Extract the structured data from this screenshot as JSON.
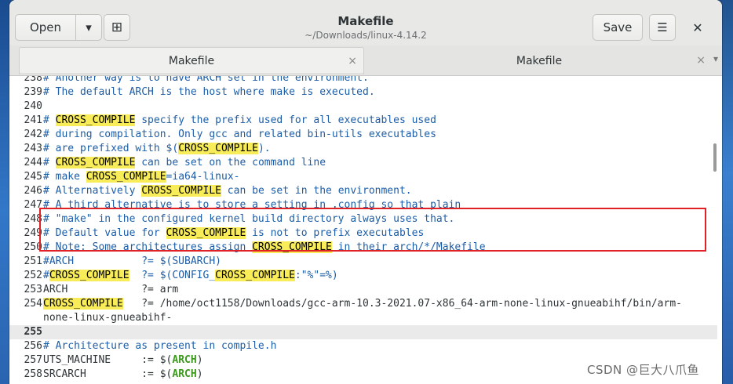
{
  "window": {
    "title": "Makefile",
    "subtitle": "~/Downloads/linux-4.14.2",
    "open_label": "Open",
    "open_menu_icon": "▾",
    "new_tab_icon": "⊞",
    "save_label": "Save",
    "menu_icon": "☰",
    "close_icon": "✕"
  },
  "tabs": [
    {
      "label": "Makefile",
      "close": "×"
    },
    {
      "label": "Makefile",
      "close": "×"
    }
  ],
  "tab_overflow_icon": "▾",
  "colors": {
    "highlight": "#f8ec58",
    "comment": "#1c5da7",
    "variable": "#3b9a1c",
    "annotation_box": "#e02226"
  },
  "lines": [
    {
      "num": "238",
      "segments": [
        {
          "t": "# Another way is to have ARCH set in the environment.",
          "s": "c"
        }
      ]
    },
    {
      "num": "239",
      "segments": [
        {
          "t": "# The default ARCH is the host where make is executed.",
          "s": "c"
        }
      ]
    },
    {
      "num": "240",
      "segments": []
    },
    {
      "num": "241",
      "segments": [
        {
          "t": "# ",
          "s": "c"
        },
        {
          "t": "CROSS_COMPILE",
          "s": "hl"
        },
        {
          "t": " specify the prefix used for all executables used",
          "s": "c"
        }
      ]
    },
    {
      "num": "242",
      "segments": [
        {
          "t": "# during compilation. Only gcc and related bin-utils executables",
          "s": "c"
        }
      ]
    },
    {
      "num": "243",
      "segments": [
        {
          "t": "# are prefixed with $(",
          "s": "c"
        },
        {
          "t": "CROSS_COMPILE",
          "s": "hl"
        },
        {
          "t": ").",
          "s": "c"
        }
      ]
    },
    {
      "num": "244",
      "segments": [
        {
          "t": "# ",
          "s": "c"
        },
        {
          "t": "CROSS_COMPILE",
          "s": "hl"
        },
        {
          "t": " can be set on the command line",
          "s": "c"
        }
      ]
    },
    {
      "num": "245",
      "segments": [
        {
          "t": "# make ",
          "s": "c"
        },
        {
          "t": "CROSS_COMPILE",
          "s": "hl"
        },
        {
          "t": "=ia64-linux-",
          "s": "c"
        }
      ]
    },
    {
      "num": "246",
      "segments": [
        {
          "t": "# Alternatively ",
          "s": "c"
        },
        {
          "t": "CROSS_COMPILE",
          "s": "hl"
        },
        {
          "t": " can be set in the environment.",
          "s": "c"
        }
      ]
    },
    {
      "num": "247",
      "segments": [
        {
          "t": "# A third alternative is to store a setting in .config so that plain",
          "s": "c"
        }
      ]
    },
    {
      "num": "248",
      "segments": [
        {
          "t": "# \"make\" in the configured kernel build directory always uses that.",
          "s": "c"
        }
      ]
    },
    {
      "num": "249",
      "segments": [
        {
          "t": "# Default value for ",
          "s": "c"
        },
        {
          "t": "CROSS_COMPILE",
          "s": "hl"
        },
        {
          "t": " is not to prefix executables",
          "s": "c"
        }
      ]
    },
    {
      "num": "250",
      "segments": [
        {
          "t": "# Note: Some architectures assign ",
          "s": "c"
        },
        {
          "t": "CROSS_COMPILE",
          "s": "hl"
        },
        {
          "t": " in their arch/*/Makefile",
          "s": "c"
        }
      ]
    },
    {
      "num": "251",
      "segments": [
        {
          "t": "#ARCH           ?= $(SUBARCH)",
          "s": "c"
        }
      ]
    },
    {
      "num": "252",
      "segments": [
        {
          "t": "#",
          "s": "c"
        },
        {
          "t": "CROSS_COMPILE",
          "s": "hl"
        },
        {
          "t": "  ?= $(CONFIG_",
          "s": "c"
        },
        {
          "t": "CROSS_COMPILE",
          "s": "hl"
        },
        {
          "t": ":\"%\"=%)",
          "s": "c"
        }
      ]
    },
    {
      "num": "253",
      "segments": [
        {
          "t": "ARCH            ?= arm",
          "s": ""
        }
      ]
    },
    {
      "num": "254",
      "segments": [
        {
          "t": "CROSS_COMPILE",
          "s": "hl"
        },
        {
          "t": "   ?= /home/oct1158/Downloads/gcc-arm-10.3-2021.07-x86_64-arm-none-linux-gnueabihf/bin/arm-",
          "s": ""
        }
      ]
    },
    {
      "num": "",
      "segments": [
        {
          "t": "none-linux-gnueabihf-",
          "s": ""
        }
      ]
    },
    {
      "num": "255",
      "segments": [],
      "current": true
    },
    {
      "num": "256",
      "segments": [
        {
          "t": "# Architecture as present in compile.h",
          "s": "c"
        }
      ]
    },
    {
      "num": "257",
      "segments": [
        {
          "t": "UTS_MACHINE     := $(",
          "s": ""
        },
        {
          "t": "ARCH",
          "s": "g"
        },
        {
          "t": ")",
          "s": ""
        }
      ]
    },
    {
      "num": "258",
      "segments": [
        {
          "t": "SRCARCH         := $(",
          "s": ""
        },
        {
          "t": "ARCH",
          "s": "g"
        },
        {
          "t": ")",
          "s": ""
        }
      ]
    }
  ],
  "watermark": "CSDN @巨大八爪鱼"
}
